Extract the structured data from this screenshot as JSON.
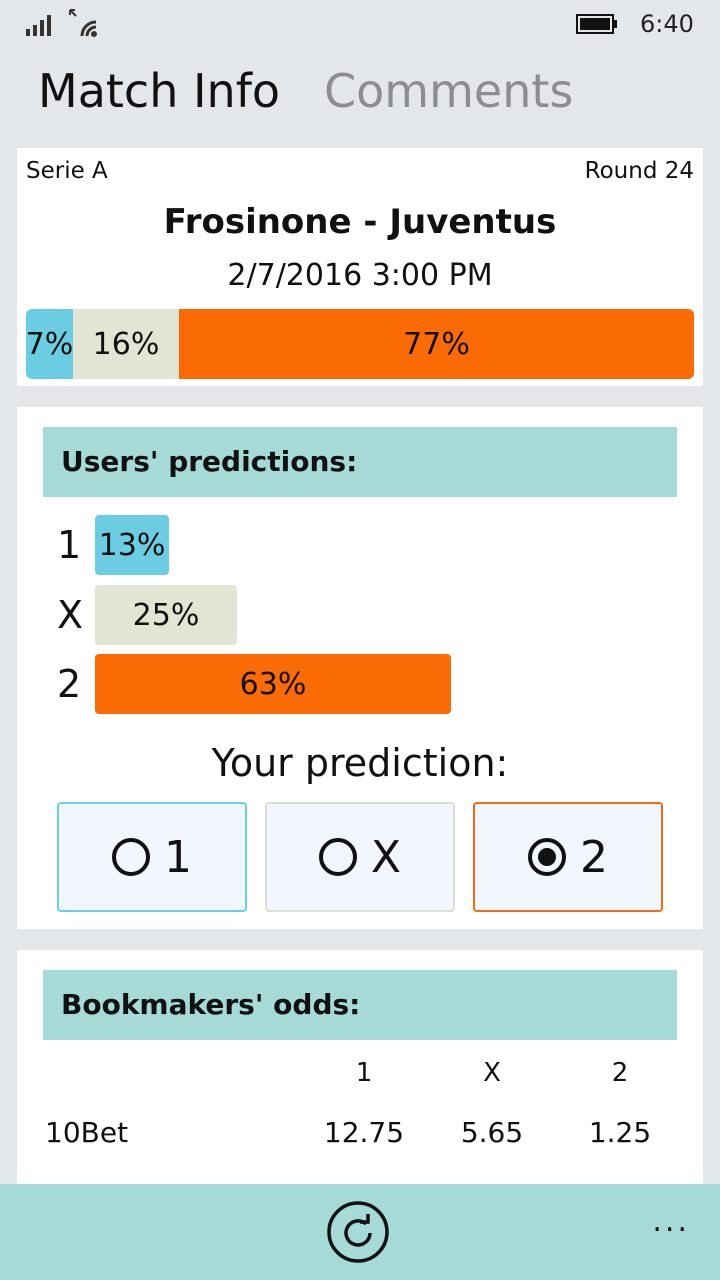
{
  "status_bar": {
    "time": "6:40"
  },
  "pivot": {
    "tabs": [
      {
        "label": "Match Info",
        "active": true
      },
      {
        "label": "Comments",
        "active": false
      }
    ]
  },
  "match": {
    "league": "Serie A",
    "round": "Round 24",
    "teams": "Frosinone - Juventus",
    "date": "2/7/2016 3:00 PM",
    "probabilities": {
      "home": "7%",
      "draw": "16%",
      "away": "77%"
    }
  },
  "users_predictions": {
    "title": "Users' predictions:",
    "rows": [
      {
        "label": "1",
        "value": "13%",
        "fraction": 0.13
      },
      {
        "label": "X",
        "value": "25%",
        "fraction": 0.25
      },
      {
        "label": "2",
        "value": "63%",
        "fraction": 0.63
      }
    ],
    "your_prediction_title": "Your prediction:",
    "options": [
      {
        "label": "1",
        "selected": false
      },
      {
        "label": "X",
        "selected": false
      },
      {
        "label": "2",
        "selected": true
      }
    ]
  },
  "odds": {
    "title": "Bookmakers' odds:",
    "columns": [
      "1",
      "X",
      "2"
    ],
    "rows": [
      {
        "bookmaker": "10Bet",
        "values": [
          "12.75",
          "5.65",
          "1.25"
        ]
      }
    ]
  },
  "appbar": {
    "refresh_icon": "refresh-icon",
    "more": "..."
  },
  "colors": {
    "home": "#6bcde2",
    "draw": "#e2e4d4",
    "away": "#fb6b05",
    "header": "#a5dad7"
  }
}
